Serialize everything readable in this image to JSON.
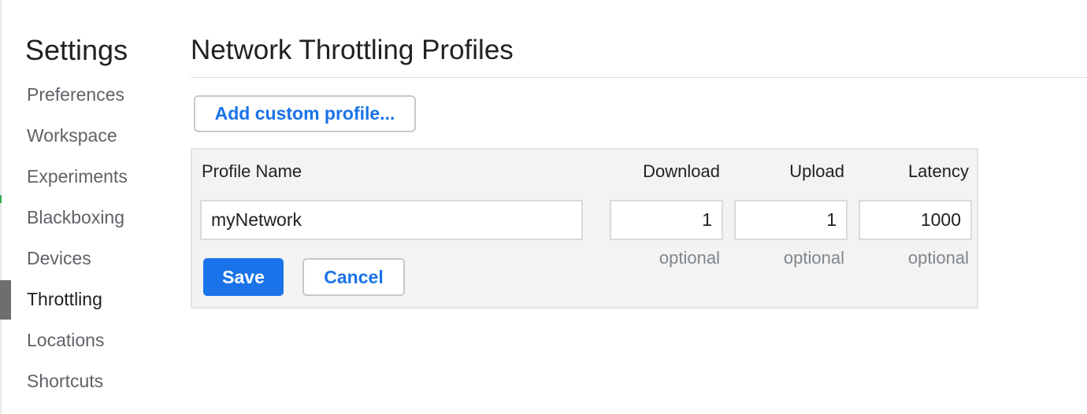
{
  "sidebar": {
    "title": "Settings",
    "items": [
      {
        "label": "Preferences"
      },
      {
        "label": "Workspace"
      },
      {
        "label": "Experiments"
      },
      {
        "label": "Blackboxing"
      },
      {
        "label": "Devices"
      },
      {
        "label": "Throttling",
        "selected": true
      },
      {
        "label": "Locations"
      },
      {
        "label": "Shortcuts"
      }
    ]
  },
  "main": {
    "title": "Network Throttling Profiles",
    "add_button_label": "Add custom profile...",
    "editor": {
      "headers": {
        "name": "Profile Name",
        "download": "Download",
        "upload": "Upload",
        "latency": "Latency"
      },
      "values": {
        "name": "myNetwork",
        "download": "1",
        "upload": "1",
        "latency": "1000"
      },
      "hints": {
        "download": "optional",
        "upload": "optional",
        "latency": "optional"
      },
      "save_label": "Save",
      "cancel_label": "Cancel"
    }
  },
  "colors": {
    "accent": "#1a73e8",
    "panel_background": "#f3f3f3",
    "selected_indicator": "#6e6e6e"
  }
}
